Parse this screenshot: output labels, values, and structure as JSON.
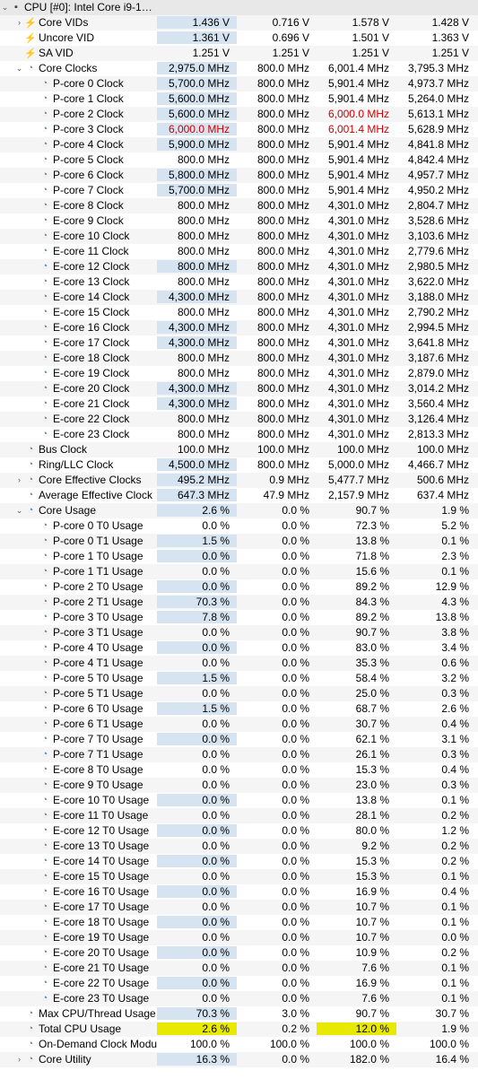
{
  "header": {
    "label": "CPU [#0]: Intel Core i9-1…"
  },
  "rows": [
    {
      "d": 1,
      "t": ">",
      "i": "bolt",
      "label": "Core VIDs",
      "c": [
        "1.436 V",
        "0.716 V",
        "1.578 V",
        "1.428 V"
      ],
      "h": [
        1,
        0,
        0,
        0
      ]
    },
    {
      "d": 1,
      "t": "",
      "i": "bolt",
      "label": "Uncore VID",
      "c": [
        "1.361 V",
        "0.696 V",
        "1.501 V",
        "1.363 V"
      ],
      "h": [
        1,
        0,
        0,
        0
      ]
    },
    {
      "d": 1,
      "t": "",
      "i": "bolt",
      "label": "SA VID",
      "c": [
        "1.251 V",
        "1.251 V",
        "1.251 V",
        "1.251 V"
      ],
      "h": [
        0,
        0,
        0,
        0
      ]
    },
    {
      "d": 1,
      "t": "v",
      "i": "clock",
      "label": "Core Clocks",
      "c": [
        "2,975.0 MHz",
        "800.0 MHz",
        "6,001.4 MHz",
        "3,795.3 MHz"
      ],
      "h": [
        1,
        0,
        0,
        0
      ]
    },
    {
      "d": 2,
      "t": "",
      "i": "clock",
      "label": "P-core 0 Clock",
      "c": [
        "5,700.0 MHz",
        "800.0 MHz",
        "5,901.4 MHz",
        "4,973.7 MHz"
      ],
      "h": [
        1,
        0,
        0,
        0
      ]
    },
    {
      "d": 2,
      "t": "",
      "i": "clock",
      "label": "P-core 1 Clock",
      "c": [
        "5,600.0 MHz",
        "800.0 MHz",
        "5,901.4 MHz",
        "5,264.0 MHz"
      ],
      "h": [
        1,
        0,
        0,
        0
      ]
    },
    {
      "d": 2,
      "t": "",
      "i": "clock",
      "label": "P-core 2 Clock",
      "c": [
        "5,600.0 MHz",
        "800.0 MHz",
        "6,000.0 MHz",
        "5,613.1 MHz"
      ],
      "h": [
        1,
        0,
        0,
        0
      ],
      "r": [
        0,
        0,
        1,
        0
      ]
    },
    {
      "d": 2,
      "t": "",
      "i": "clock",
      "label": "P-core 3 Clock",
      "c": [
        "6,000.0 MHz",
        "800.0 MHz",
        "6,001.4 MHz",
        "5,628.9 MHz"
      ],
      "h": [
        1,
        0,
        0,
        0
      ],
      "r": [
        1,
        0,
        1,
        0
      ]
    },
    {
      "d": 2,
      "t": "",
      "i": "clock",
      "label": "P-core 4 Clock",
      "c": [
        "5,900.0 MHz",
        "800.0 MHz",
        "5,901.4 MHz",
        "4,841.8 MHz"
      ],
      "h": [
        1,
        0,
        0,
        0
      ]
    },
    {
      "d": 2,
      "t": "",
      "i": "clock",
      "label": "P-core 5 Clock",
      "c": [
        "800.0 MHz",
        "800.0 MHz",
        "5,901.4 MHz",
        "4,842.4 MHz"
      ],
      "h": [
        0,
        0,
        0,
        0
      ]
    },
    {
      "d": 2,
      "t": "",
      "i": "clock",
      "label": "P-core 6 Clock",
      "c": [
        "5,800.0 MHz",
        "800.0 MHz",
        "5,901.4 MHz",
        "4,957.7 MHz"
      ],
      "h": [
        1,
        0,
        0,
        0
      ]
    },
    {
      "d": 2,
      "t": "",
      "i": "clock",
      "label": "P-core 7 Clock",
      "c": [
        "5,700.0 MHz",
        "800.0 MHz",
        "5,901.4 MHz",
        "4,950.2 MHz"
      ],
      "h": [
        1,
        0,
        0,
        0
      ]
    },
    {
      "d": 2,
      "t": "",
      "i": "clock",
      "label": "E-core 8 Clock",
      "c": [
        "800.0 MHz",
        "800.0 MHz",
        "4,301.0 MHz",
        "2,804.7 MHz"
      ],
      "h": [
        0,
        0,
        0,
        0
      ]
    },
    {
      "d": 2,
      "t": "",
      "i": "clock",
      "label": "E-core 9 Clock",
      "c": [
        "800.0 MHz",
        "800.0 MHz",
        "4,301.0 MHz",
        "3,528.6 MHz"
      ],
      "h": [
        0,
        0,
        0,
        0
      ]
    },
    {
      "d": 2,
      "t": "",
      "i": "clock",
      "label": "E-core 10 Clock",
      "c": [
        "800.0 MHz",
        "800.0 MHz",
        "4,301.0 MHz",
        "3,103.6 MHz"
      ],
      "h": [
        0,
        0,
        0,
        0
      ]
    },
    {
      "d": 2,
      "t": "",
      "i": "clock",
      "label": "E-core 11 Clock",
      "c": [
        "800.0 MHz",
        "800.0 MHz",
        "4,301.0 MHz",
        "2,779.6 MHz"
      ],
      "h": [
        0,
        0,
        0,
        0
      ]
    },
    {
      "d": 2,
      "t": "",
      "i": "clock",
      "label": "E-core 12 Clock",
      "c": [
        "800.0 MHz",
        "800.0 MHz",
        "4,301.0 MHz",
        "2,980.5 MHz"
      ],
      "h": [
        1,
        0,
        0,
        0
      ]
    },
    {
      "d": 2,
      "t": "",
      "i": "clock",
      "label": "E-core 13 Clock",
      "c": [
        "800.0 MHz",
        "800.0 MHz",
        "4,301.0 MHz",
        "3,622.0 MHz"
      ],
      "h": [
        0,
        0,
        0,
        0
      ]
    },
    {
      "d": 2,
      "t": "",
      "i": "clock",
      "label": "E-core 14 Clock",
      "c": [
        "4,300.0 MHz",
        "800.0 MHz",
        "4,301.0 MHz",
        "3,188.0 MHz"
      ],
      "h": [
        1,
        0,
        0,
        0
      ]
    },
    {
      "d": 2,
      "t": "",
      "i": "clock",
      "label": "E-core 15 Clock",
      "c": [
        "800.0 MHz",
        "800.0 MHz",
        "4,301.0 MHz",
        "2,790.2 MHz"
      ],
      "h": [
        0,
        0,
        0,
        0
      ]
    },
    {
      "d": 2,
      "t": "",
      "i": "clock",
      "label": "E-core 16 Clock",
      "c": [
        "4,300.0 MHz",
        "800.0 MHz",
        "4,301.0 MHz",
        "2,994.5 MHz"
      ],
      "h": [
        1,
        0,
        0,
        0
      ]
    },
    {
      "d": 2,
      "t": "",
      "i": "clock",
      "label": "E-core 17 Clock",
      "c": [
        "4,300.0 MHz",
        "800.0 MHz",
        "4,301.0 MHz",
        "3,641.8 MHz"
      ],
      "h": [
        1,
        0,
        0,
        0
      ]
    },
    {
      "d": 2,
      "t": "",
      "i": "clock",
      "label": "E-core 18 Clock",
      "c": [
        "800.0 MHz",
        "800.0 MHz",
        "4,301.0 MHz",
        "3,187.6 MHz"
      ],
      "h": [
        0,
        0,
        0,
        0
      ]
    },
    {
      "d": 2,
      "t": "",
      "i": "clock",
      "label": "E-core 19 Clock",
      "c": [
        "800.0 MHz",
        "800.0 MHz",
        "4,301.0 MHz",
        "2,879.0 MHz"
      ],
      "h": [
        0,
        0,
        0,
        0
      ]
    },
    {
      "d": 2,
      "t": "",
      "i": "clock",
      "label": "E-core 20 Clock",
      "c": [
        "4,300.0 MHz",
        "800.0 MHz",
        "4,301.0 MHz",
        "3,014.2 MHz"
      ],
      "h": [
        1,
        0,
        0,
        0
      ]
    },
    {
      "d": 2,
      "t": "",
      "i": "clock",
      "label": "E-core 21 Clock",
      "c": [
        "4,300.0 MHz",
        "800.0 MHz",
        "4,301.0 MHz",
        "3,560.4 MHz"
      ],
      "h": [
        1,
        0,
        0,
        0
      ]
    },
    {
      "d": 2,
      "t": "",
      "i": "clock",
      "label": "E-core 22 Clock",
      "c": [
        "800.0 MHz",
        "800.0 MHz",
        "4,301.0 MHz",
        "3,126.4 MHz"
      ],
      "h": [
        0,
        0,
        0,
        0
      ]
    },
    {
      "d": 2,
      "t": "",
      "i": "clock",
      "label": "E-core 23 Clock",
      "c": [
        "800.0 MHz",
        "800.0 MHz",
        "4,301.0 MHz",
        "2,813.3 MHz"
      ],
      "h": [
        0,
        0,
        0,
        0
      ]
    },
    {
      "d": 1,
      "t": "",
      "i": "clock",
      "label": "Bus Clock",
      "c": [
        "100.0 MHz",
        "100.0 MHz",
        "100.0 MHz",
        "100.0 MHz"
      ],
      "h": [
        0,
        0,
        0,
        0
      ]
    },
    {
      "d": 1,
      "t": "",
      "i": "clock",
      "label": "Ring/LLC Clock",
      "c": [
        "4,500.0 MHz",
        "800.0 MHz",
        "5,000.0 MHz",
        "4,466.7 MHz"
      ],
      "h": [
        1,
        0,
        0,
        0
      ]
    },
    {
      "d": 1,
      "t": ">",
      "i": "clock",
      "label": "Core Effective Clocks",
      "c": [
        "495.2 MHz",
        "0.9 MHz",
        "5,477.7 MHz",
        "500.6 MHz"
      ],
      "h": [
        1,
        0,
        0,
        0
      ]
    },
    {
      "d": 1,
      "t": "",
      "i": "clock",
      "label": "Average Effective Clock",
      "c": [
        "647.3 MHz",
        "47.9 MHz",
        "2,157.9 MHz",
        "637.4 MHz"
      ],
      "h": [
        1,
        0,
        0,
        0
      ]
    },
    {
      "d": 1,
      "t": "v",
      "i": "clock",
      "label": "Core Usage",
      "c": [
        "2.6 %",
        "0.0 %",
        "90.7 %",
        "1.9 %"
      ],
      "h": [
        1,
        0,
        0,
        0
      ]
    },
    {
      "d": 2,
      "t": "",
      "i": "clock",
      "label": "P-core 0 T0 Usage",
      "c": [
        "0.0 %",
        "0.0 %",
        "72.3 %",
        "5.2 %"
      ],
      "h": [
        0,
        0,
        0,
        0
      ]
    },
    {
      "d": 2,
      "t": "",
      "i": "clock",
      "label": "P-core 0 T1 Usage",
      "c": [
        "1.5 %",
        "0.0 %",
        "13.8 %",
        "0.1 %"
      ],
      "h": [
        1,
        0,
        0,
        0
      ]
    },
    {
      "d": 2,
      "t": "",
      "i": "clock",
      "label": "P-core 1 T0 Usage",
      "c": [
        "0.0 %",
        "0.0 %",
        "71.8 %",
        "2.3 %"
      ],
      "h": [
        1,
        0,
        0,
        0
      ]
    },
    {
      "d": 2,
      "t": "",
      "i": "clock",
      "label": "P-core 1 T1 Usage",
      "c": [
        "0.0 %",
        "0.0 %",
        "15.6 %",
        "0.1 %"
      ],
      "h": [
        0,
        0,
        0,
        0
      ]
    },
    {
      "d": 2,
      "t": "",
      "i": "clock",
      "label": "P-core 2 T0 Usage",
      "c": [
        "0.0 %",
        "0.0 %",
        "89.2 %",
        "12.9 %"
      ],
      "h": [
        1,
        0,
        0,
        0
      ]
    },
    {
      "d": 2,
      "t": "",
      "i": "clock",
      "label": "P-core 2 T1 Usage",
      "c": [
        "70.3 %",
        "0.0 %",
        "84.3 %",
        "4.3 %"
      ],
      "h": [
        1,
        0,
        0,
        0
      ]
    },
    {
      "d": 2,
      "t": "",
      "i": "clock",
      "label": "P-core 3 T0 Usage",
      "c": [
        "7.8 %",
        "0.0 %",
        "89.2 %",
        "13.8 %"
      ],
      "h": [
        1,
        0,
        0,
        0
      ]
    },
    {
      "d": 2,
      "t": "",
      "i": "clock",
      "label": "P-core 3 T1 Usage",
      "c": [
        "0.0 %",
        "0.0 %",
        "90.7 %",
        "3.8 %"
      ],
      "h": [
        0,
        0,
        0,
        0
      ]
    },
    {
      "d": 2,
      "t": "",
      "i": "clock",
      "label": "P-core 4 T0 Usage",
      "c": [
        "0.0 %",
        "0.0 %",
        "83.0 %",
        "3.4 %"
      ],
      "h": [
        1,
        0,
        0,
        0
      ]
    },
    {
      "d": 2,
      "t": "",
      "i": "clock",
      "label": "P-core 4 T1 Usage",
      "c": [
        "0.0 %",
        "0.0 %",
        "35.3 %",
        "0.6 %"
      ],
      "h": [
        0,
        0,
        0,
        0
      ]
    },
    {
      "d": 2,
      "t": "",
      "i": "clock",
      "label": "P-core 5 T0 Usage",
      "c": [
        "1.5 %",
        "0.0 %",
        "58.4 %",
        "3.2 %"
      ],
      "h": [
        1,
        0,
        0,
        0
      ]
    },
    {
      "d": 2,
      "t": "",
      "i": "clock",
      "label": "P-core 5 T1 Usage",
      "c": [
        "0.0 %",
        "0.0 %",
        "25.0 %",
        "0.3 %"
      ],
      "h": [
        0,
        0,
        0,
        0
      ]
    },
    {
      "d": 2,
      "t": "",
      "i": "clock",
      "label": "P-core 6 T0 Usage",
      "c": [
        "1.5 %",
        "0.0 %",
        "68.7 %",
        "2.6 %"
      ],
      "h": [
        1,
        0,
        0,
        0
      ]
    },
    {
      "d": 2,
      "t": "",
      "i": "clock",
      "label": "P-core 6 T1 Usage",
      "c": [
        "0.0 %",
        "0.0 %",
        "30.7 %",
        "0.4 %"
      ],
      "h": [
        0,
        0,
        0,
        0
      ]
    },
    {
      "d": 2,
      "t": "",
      "i": "clock",
      "label": "P-core 7 T0 Usage",
      "c": [
        "0.0 %",
        "0.0 %",
        "62.1 %",
        "3.1 %"
      ],
      "h": [
        1,
        0,
        0,
        0
      ]
    },
    {
      "d": 2,
      "t": "",
      "i": "clock",
      "label": "P-core 7 T1 Usage",
      "c": [
        "0.0 %",
        "0.0 %",
        "26.1 %",
        "0.3 %"
      ],
      "h": [
        0,
        0,
        0,
        0
      ]
    },
    {
      "d": 2,
      "t": "",
      "i": "clock",
      "label": "E-core 8 T0 Usage",
      "c": [
        "0.0 %",
        "0.0 %",
        "15.3 %",
        "0.4 %"
      ],
      "h": [
        0,
        0,
        0,
        0
      ]
    },
    {
      "d": 2,
      "t": "",
      "i": "clock",
      "label": "E-core 9 T0 Usage",
      "c": [
        "0.0 %",
        "0.0 %",
        "23.0 %",
        "0.3 %"
      ],
      "h": [
        0,
        0,
        0,
        0
      ]
    },
    {
      "d": 2,
      "t": "",
      "i": "clock",
      "label": "E-core 10 T0 Usage",
      "c": [
        "0.0 %",
        "0.0 %",
        "13.8 %",
        "0.1 %"
      ],
      "h": [
        1,
        0,
        0,
        0
      ]
    },
    {
      "d": 2,
      "t": "",
      "i": "clock",
      "label": "E-core 11 T0 Usage",
      "c": [
        "0.0 %",
        "0.0 %",
        "28.1 %",
        "0.2 %"
      ],
      "h": [
        0,
        0,
        0,
        0
      ]
    },
    {
      "d": 2,
      "t": "",
      "i": "clock",
      "label": "E-core 12 T0 Usage",
      "c": [
        "0.0 %",
        "0.0 %",
        "80.0 %",
        "1.2 %"
      ],
      "h": [
        1,
        0,
        0,
        0
      ]
    },
    {
      "d": 2,
      "t": "",
      "i": "clock",
      "label": "E-core 13 T0 Usage",
      "c": [
        "0.0 %",
        "0.0 %",
        "9.2 %",
        "0.2 %"
      ],
      "h": [
        0,
        0,
        0,
        0
      ]
    },
    {
      "d": 2,
      "t": "",
      "i": "clock",
      "label": "E-core 14 T0 Usage",
      "c": [
        "0.0 %",
        "0.0 %",
        "15.3 %",
        "0.2 %"
      ],
      "h": [
        1,
        0,
        0,
        0
      ]
    },
    {
      "d": 2,
      "t": "",
      "i": "clock",
      "label": "E-core 15 T0 Usage",
      "c": [
        "0.0 %",
        "0.0 %",
        "15.3 %",
        "0.1 %"
      ],
      "h": [
        0,
        0,
        0,
        0
      ]
    },
    {
      "d": 2,
      "t": "",
      "i": "clock",
      "label": "E-core 16 T0 Usage",
      "c": [
        "0.0 %",
        "0.0 %",
        "16.9 %",
        "0.4 %"
      ],
      "h": [
        1,
        0,
        0,
        0
      ]
    },
    {
      "d": 2,
      "t": "",
      "i": "clock",
      "label": "E-core 17 T0 Usage",
      "c": [
        "0.0 %",
        "0.0 %",
        "10.7 %",
        "0.1 %"
      ],
      "h": [
        0,
        0,
        0,
        0
      ]
    },
    {
      "d": 2,
      "t": "",
      "i": "clock",
      "label": "E-core 18 T0 Usage",
      "c": [
        "0.0 %",
        "0.0 %",
        "10.7 %",
        "0.1 %"
      ],
      "h": [
        1,
        0,
        0,
        0
      ]
    },
    {
      "d": 2,
      "t": "",
      "i": "clock",
      "label": "E-core 19 T0 Usage",
      "c": [
        "0.0 %",
        "0.0 %",
        "10.7 %",
        "0.0 %"
      ],
      "h": [
        0,
        0,
        0,
        0
      ]
    },
    {
      "d": 2,
      "t": "",
      "i": "clock",
      "label": "E-core 20 T0 Usage",
      "c": [
        "0.0 %",
        "0.0 %",
        "10.9 %",
        "0.2 %"
      ],
      "h": [
        1,
        0,
        0,
        0
      ]
    },
    {
      "d": 2,
      "t": "",
      "i": "clock",
      "label": "E-core 21 T0 Usage",
      "c": [
        "0.0 %",
        "0.0 %",
        "7.6 %",
        "0.1 %"
      ],
      "h": [
        0,
        0,
        0,
        0
      ]
    },
    {
      "d": 2,
      "t": "",
      "i": "clock",
      "label": "E-core 22 T0 Usage",
      "c": [
        "0.0 %",
        "0.0 %",
        "16.9 %",
        "0.1 %"
      ],
      "h": [
        1,
        0,
        0,
        0
      ]
    },
    {
      "d": 2,
      "t": "",
      "i": "clock",
      "label": "E-core 23 T0 Usage",
      "c": [
        "0.0 %",
        "0.0 %",
        "7.6 %",
        "0.1 %"
      ],
      "h": [
        0,
        0,
        0,
        0
      ]
    },
    {
      "d": 1,
      "t": "",
      "i": "clock",
      "label": "Max CPU/Thread Usage",
      "c": [
        "70.3 %",
        "3.0 %",
        "90.7 %",
        "30.7 %"
      ],
      "h": [
        1,
        0,
        0,
        0
      ]
    },
    {
      "d": 1,
      "t": "",
      "i": "clock",
      "label": "Total CPU Usage",
      "c": [
        "2.6 %",
        "0.2 %",
        "12.0 %",
        "1.9 %"
      ],
      "h": [
        2,
        0,
        2,
        0
      ]
    },
    {
      "d": 1,
      "t": "",
      "i": "clock",
      "label": "On-Demand Clock Modul…",
      "c": [
        "100.0 %",
        "100.0 %",
        "100.0 %",
        "100.0 %"
      ],
      "h": [
        0,
        0,
        0,
        0
      ]
    },
    {
      "d": 1,
      "t": ">",
      "i": "clock",
      "label": "Core Utility",
      "c": [
        "16.3 %",
        "0.0 %",
        "182.0 %",
        "16.4 %"
      ],
      "h": [
        1,
        0,
        0,
        0
      ]
    }
  ]
}
